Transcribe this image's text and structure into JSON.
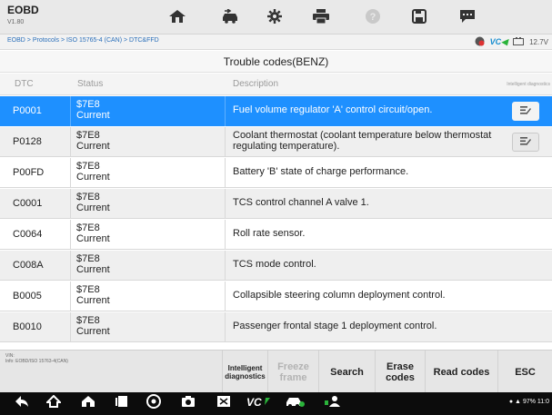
{
  "app": {
    "title": "EOBD",
    "version": "V1.80"
  },
  "toolbar": {
    "icons": [
      "home-icon",
      "vehicle-swap-icon",
      "settings-icon",
      "print-icon",
      "help-icon",
      "save-icon",
      "message-icon"
    ]
  },
  "breadcrumb": "EOBD > Protocols > ISO 15765-4 (CAN) > DTC&FFD",
  "statusbar": {
    "vci": "VC",
    "voltage": "12.7V"
  },
  "table": {
    "title": "Trouble codes(BENZ)",
    "headers": {
      "dtc": "DTC",
      "status": "Status",
      "description": "Description",
      "intelligent": "Intelligent diagnostics"
    },
    "rows": [
      {
        "dtc": "P0001",
        "status_line1": "$7E8",
        "status_line2": "Current",
        "description": "Fuel volume regulator 'A' control circuit/open.",
        "has_button": true,
        "selected": true
      },
      {
        "dtc": "P0128",
        "status_line1": "$7E8",
        "status_line2": "Current",
        "description": "Coolant thermostat (coolant temperature below thermostat regulating temperature).",
        "has_button": true,
        "selected": false
      },
      {
        "dtc": "P00FD",
        "status_line1": "$7E8",
        "status_line2": "Current",
        "description": "Battery 'B' state of charge performance.",
        "has_button": false,
        "selected": false
      },
      {
        "dtc": "C0001",
        "status_line1": "$7E8",
        "status_line2": "Current",
        "description": "TCS control channel A valve 1.",
        "has_button": false,
        "selected": false
      },
      {
        "dtc": "C0064",
        "status_line1": "$7E8",
        "status_line2": "Current",
        "description": "Roll rate sensor.",
        "has_button": false,
        "selected": false
      },
      {
        "dtc": "C008A",
        "status_line1": "$7E8",
        "status_line2": "Current",
        "description": "TCS mode control.",
        "has_button": false,
        "selected": false
      },
      {
        "dtc": "B0005",
        "status_line1": "$7E8",
        "status_line2": "Current",
        "description": "Collapsible steering column deployment control.",
        "has_button": false,
        "selected": false
      },
      {
        "dtc": "B0010",
        "status_line1": "$7E8",
        "status_line2": "Current",
        "description": "Passenger frontal stage 1 deployment control.",
        "has_button": false,
        "selected": false
      }
    ]
  },
  "footer": {
    "vin_label": "VIN:",
    "info_label": "Info: EOBD/ISO 15763-4(CAN)",
    "buttons": {
      "intelligent": "Intelligent diagnostics",
      "freeze": "Freeze frame",
      "search": "Search",
      "erase": "Erase codes",
      "read": "Read codes",
      "esc": "ESC"
    }
  },
  "android_status": "97% 11:0",
  "colors": {
    "selected_row": "#1e90ff",
    "vci_blue": "#1a8fd0",
    "nav_bar": "#0c0c0c"
  }
}
